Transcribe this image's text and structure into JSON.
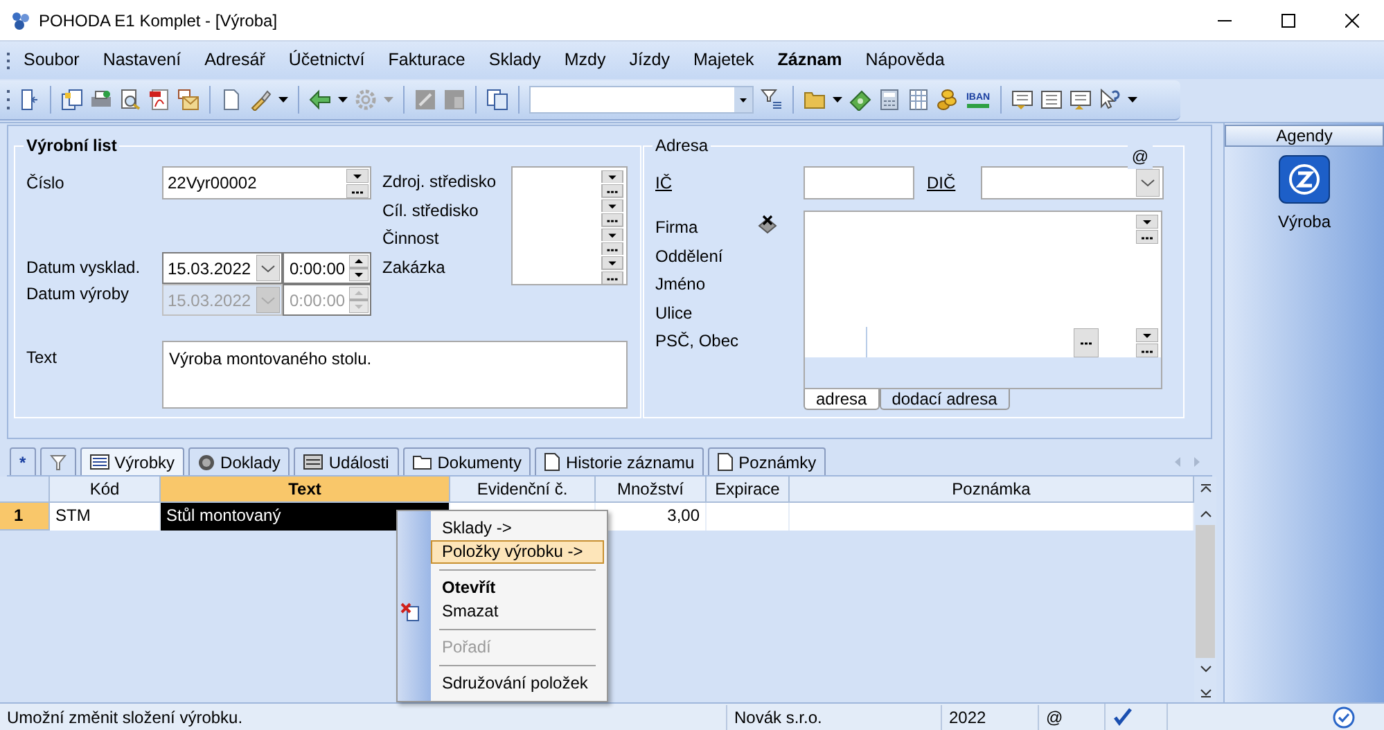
{
  "window": {
    "title": "POHODA E1 Komplet - [Výroba]"
  },
  "menu": [
    {
      "label": "Soubor",
      "bold": false
    },
    {
      "label": "Nastavení",
      "bold": false
    },
    {
      "label": "Adresář",
      "bold": false
    },
    {
      "label": "Účetnictví",
      "bold": false
    },
    {
      "label": "Fakturace",
      "bold": false
    },
    {
      "label": "Sklady",
      "bold": false
    },
    {
      "label": "Mzdy",
      "bold": false
    },
    {
      "label": "Jízdy",
      "bold": false
    },
    {
      "label": "Majetek",
      "bold": false
    },
    {
      "label": "Záznam",
      "bold": true
    },
    {
      "label": "Nápověda",
      "bold": false
    }
  ],
  "toolbar": {
    "iban_label": "IBAN"
  },
  "vyrobni_list": {
    "title": "Výrobní list",
    "cislo": {
      "label": "Číslo",
      "value": "22Vyr00002"
    },
    "dates": [
      {
        "label": "Datum vysklad.",
        "date": "15.03.2022",
        "time": "0:00:00",
        "disabled": false
      },
      {
        "label": "Datum výroby",
        "date": "15.03.2022",
        "time": "0:00:00",
        "disabled": true
      }
    ],
    "text": {
      "label": "Text",
      "value": "Výroba montovaného stolu."
    },
    "center_labels": [
      "Zdroj. středisko",
      "Cíl. středisko",
      "Činnost",
      "Zakázka"
    ]
  },
  "adresa": {
    "title": "Adresa",
    "at": "@",
    "ic_label": "IČ",
    "dic_label": "DIČ",
    "labels": [
      "Firma",
      "Oddělení",
      "Jméno",
      "Ulice",
      "PSČ, Obec"
    ],
    "tabs": [
      {
        "label": "adresa",
        "selected": true
      },
      {
        "label": "dodací adresa",
        "selected": false
      }
    ]
  },
  "agendy": {
    "title": "Agendy",
    "items": [
      {
        "label": "Výroba"
      }
    ]
  },
  "detail_tabs": [
    {
      "kind": "symbol",
      "label": "*",
      "selected": false
    },
    {
      "kind": "filter",
      "selected": false
    },
    {
      "kind": "list",
      "label": "Výrobky",
      "selected": true
    },
    {
      "kind": "disc",
      "label": "Doklady",
      "selected": false
    },
    {
      "kind": "card",
      "label": "Události",
      "selected": false
    },
    {
      "kind": "folder",
      "label": "Dokumenty",
      "selected": false
    },
    {
      "kind": "page",
      "label": "Historie záznamu",
      "selected": false
    },
    {
      "kind": "page",
      "label": "Poznámky",
      "selected": false
    }
  ],
  "table": {
    "columns": [
      {
        "label": "Kód",
        "highlighted": false
      },
      {
        "label": "Text",
        "highlighted": true
      },
      {
        "label": "Evidenční č.",
        "highlighted": false
      },
      {
        "label": "Množství",
        "highlighted": false
      },
      {
        "label": "Expirace",
        "highlighted": false
      },
      {
        "label": "Poznámka",
        "highlighted": false
      }
    ],
    "rows": [
      {
        "number": "1",
        "current": true,
        "cells": [
          {
            "text": "STM",
            "focused": false
          },
          {
            "text": "Stůl montovaný",
            "focused": true
          },
          {
            "focused": false
          },
          {
            "text": "3,00",
            "focused": false
          },
          {
            "focused": false
          },
          {
            "focused": false
          }
        ]
      }
    ]
  },
  "context_menu": [
    {
      "kind": "item",
      "label": "Sklady ->",
      "selected": false,
      "bold": false,
      "disabled": false
    },
    {
      "kind": "item",
      "label": "Položky výrobku ->",
      "selected": true,
      "bold": false,
      "disabled": false
    },
    {
      "kind": "separator"
    },
    {
      "kind": "item",
      "label": "Otevřít",
      "selected": false,
      "bold": true,
      "disabled": false
    },
    {
      "kind": "delete",
      "label": "Smazat",
      "selected": false,
      "bold": false,
      "disabled": false
    },
    {
      "kind": "separator"
    },
    {
      "kind": "item",
      "label": "Pořadí",
      "selected": false,
      "bold": false,
      "disabled": true
    },
    {
      "kind": "separator"
    },
    {
      "kind": "item",
      "label": "Sdružování položek",
      "selected": false,
      "bold": false,
      "disabled": false
    }
  ],
  "status_bar": {
    "message": "Umožní změnit složení výrobku.",
    "company": "Novák s.r.o.",
    "year": "2022",
    "at": "@"
  }
}
